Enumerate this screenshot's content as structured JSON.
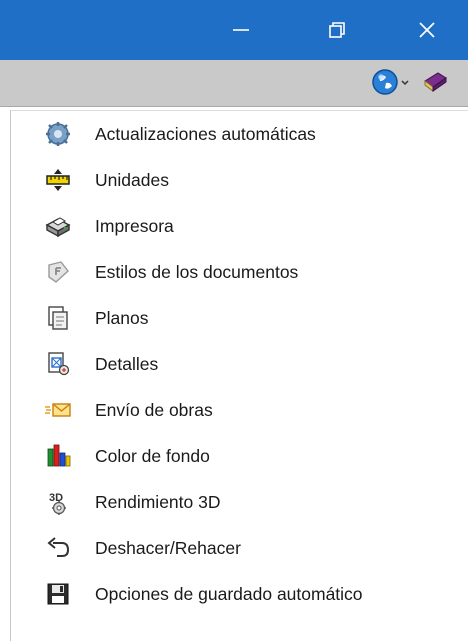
{
  "window": {
    "title_buttons": [
      {
        "name": "minimize",
        "glyph": "—"
      },
      {
        "name": "restore",
        "glyph": "⧉"
      },
      {
        "name": "close",
        "glyph": "✕"
      }
    ]
  },
  "toolbar": {
    "tools": [
      {
        "name": "globe-dropdown",
        "icon": "globe-icon"
      },
      {
        "name": "book-dropdown",
        "icon": "book-icon"
      }
    ]
  },
  "menu": {
    "items": [
      {
        "label": "Actualizaciones automáticas",
        "icon": "gear-update-icon"
      },
      {
        "label": "Unidades",
        "icon": "ruler-icon"
      },
      {
        "label": "Impresora",
        "icon": "printer-icon"
      },
      {
        "label": "Estilos de los documentos",
        "icon": "document-style-icon"
      },
      {
        "label": "Planos",
        "icon": "plans-icon"
      },
      {
        "label": "Detalles",
        "icon": "details-icon"
      },
      {
        "label": "Envío de obras",
        "icon": "send-mail-icon"
      },
      {
        "label": "Color de fondo",
        "icon": "background-color-icon"
      },
      {
        "label": "Rendimiento 3D",
        "icon": "3d-performance-icon"
      },
      {
        "label": "Deshacer/Rehacer",
        "icon": "undo-icon"
      },
      {
        "label": "Opciones de guardado automático",
        "icon": "floppy-save-icon"
      }
    ]
  },
  "colors": {
    "titlebar": "#1f6fc6",
    "toolbar": "#c9c9c9",
    "menu_background": "#ffffff",
    "text": "#1a1a1a"
  }
}
